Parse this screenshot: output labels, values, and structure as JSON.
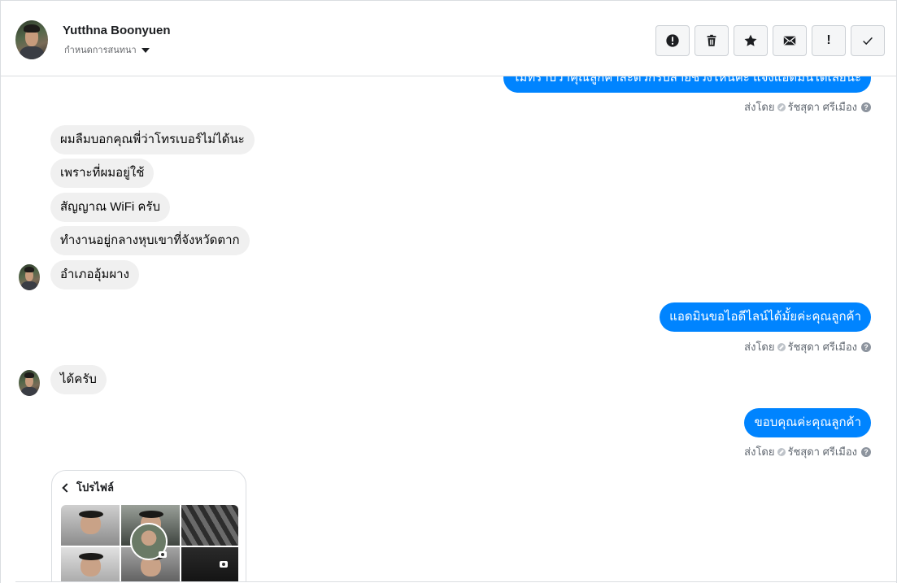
{
  "header": {
    "name": "Yutthna Boonyuen",
    "subtitle": "กำหนดการสนทนา"
  },
  "toolbar": {
    "buttons": [
      {
        "icon": "alert-circle-icon"
      },
      {
        "icon": "trash-icon"
      },
      {
        "icon": "star-icon"
      },
      {
        "icon": "envelope-icon"
      },
      {
        "icon": "exclamation-icon",
        "label": "!"
      },
      {
        "icon": "check-icon"
      }
    ]
  },
  "messages": {
    "out_top_cut": "ไม่ทราบว่าคุณลูกค้าสะดวกรับสายช่วงไหนคะ แจ้งแอดมินได้เลยนะ",
    "sent_by_label": "ส่งโดย",
    "sender": "รัชสุดา ศรีเมือง",
    "help": "?",
    "in_group1": [
      "ผมลืมบอกคุณพี่ว่าโทรเบอร์ไม่ได้นะ",
      "เพราะที่ผมอยู่ใช้",
      "สัญญาณ WiFi ครับ",
      "ทำงานอยู่กลางหุบเขาที่จังหวัดตาก",
      "อำเภออุ้มผาง"
    ],
    "out_line_id": "แอดมินขอไอดีไลน์ได้มั้ยค่ะคุณลูกค้า",
    "in_ok": "ได้ครับ",
    "out_thanks": "ขอบคุณค่ะคุณลูกค้า",
    "card_title": "โปรไฟล์"
  },
  "colors": {
    "outgoing": "#0084ff",
    "incoming": "#f0f0f0"
  }
}
